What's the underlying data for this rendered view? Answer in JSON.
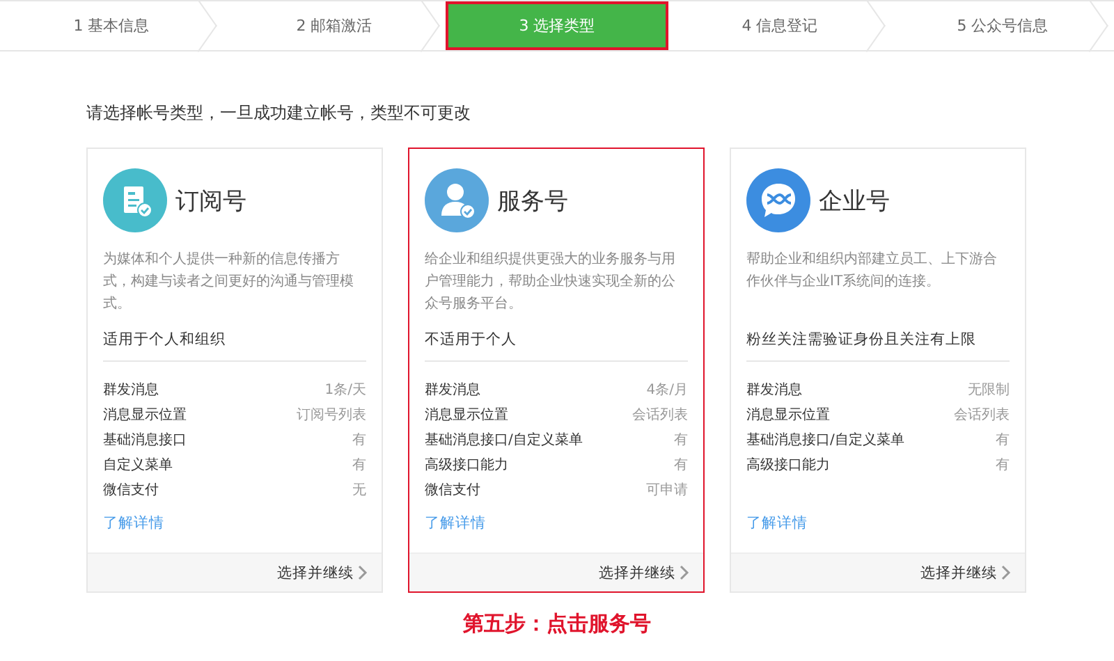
{
  "steps": [
    {
      "label": "1 基本信息",
      "selected": false
    },
    {
      "label": "2 邮箱激活",
      "selected": false
    },
    {
      "label": "3 选择类型",
      "selected": true
    },
    {
      "label": "4 信息登记",
      "selected": false
    },
    {
      "label": "5 公众号信息",
      "selected": false
    }
  ],
  "instruction": "请选择帐号类型，一旦成功建立帐号，类型不可更改",
  "cards": [
    {
      "kind": "subscription",
      "title": "订阅号",
      "selected": false,
      "description": "为媒体和个人提供一种新的信息传播方式，构建与读者之间更好的沟通与管理模式。",
      "audience": "适用于个人和组织",
      "features": [
        {
          "name": "群发消息",
          "value": "1条/天"
        },
        {
          "name": "消息显示位置",
          "value": "订阅号列表"
        },
        {
          "name": "基础消息接口",
          "value": "有"
        },
        {
          "name": "自定义菜单",
          "value": "有"
        },
        {
          "name": "微信支付",
          "value": "无"
        }
      ],
      "link": "了解详情",
      "action": "选择并继续"
    },
    {
      "kind": "service",
      "title": "服务号",
      "selected": true,
      "description": "给企业和组织提供更强大的业务服务与用户管理能力，帮助企业快速实现全新的公众号服务平台。",
      "audience": "不适用于个人",
      "features": [
        {
          "name": "群发消息",
          "value": "4条/月"
        },
        {
          "name": "消息显示位置",
          "value": "会话列表"
        },
        {
          "name": "基础消息接口/自定义菜单",
          "value": "有"
        },
        {
          "name": "高级接口能力",
          "value": "有"
        },
        {
          "name": "微信支付",
          "value": "可申请"
        }
      ],
      "link": "了解详情",
      "action": "选择并继续"
    },
    {
      "kind": "enterprise",
      "title": "企业号",
      "selected": false,
      "description": "帮助企业和组织内部建立员工、上下游合作伙伴与企业IT系统间的连接。",
      "audience": "粉丝关注需验证身份且关注有上限",
      "features": [
        {
          "name": "群发消息",
          "value": "无限制"
        },
        {
          "name": "消息显示位置",
          "value": "会话列表"
        },
        {
          "name": "基础消息接口/自定义菜单",
          "value": "有"
        },
        {
          "name": "高级接口能力",
          "value": "有"
        }
      ],
      "link": "了解详情",
      "action": "选择并继续"
    }
  ],
  "annotation": "第五步：点击服务号"
}
